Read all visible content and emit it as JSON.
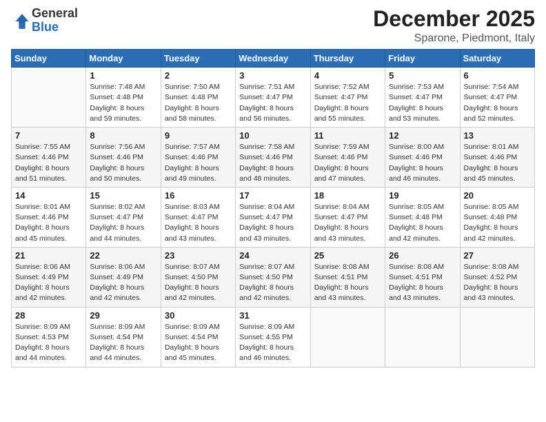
{
  "logo": {
    "general": "General",
    "blue": "Blue"
  },
  "header": {
    "month": "December 2025",
    "location": "Sparone, Piedmont, Italy"
  },
  "weekdays": [
    "Sunday",
    "Monday",
    "Tuesday",
    "Wednesday",
    "Thursday",
    "Friday",
    "Saturday"
  ],
  "weeks": [
    [
      {
        "day": "",
        "sunrise": "",
        "sunset": "",
        "daylight": ""
      },
      {
        "day": "1",
        "sunrise": "Sunrise: 7:48 AM",
        "sunset": "Sunset: 4:48 PM",
        "daylight": "Daylight: 8 hours and 59 minutes."
      },
      {
        "day": "2",
        "sunrise": "Sunrise: 7:50 AM",
        "sunset": "Sunset: 4:48 PM",
        "daylight": "Daylight: 8 hours and 58 minutes."
      },
      {
        "day": "3",
        "sunrise": "Sunrise: 7:51 AM",
        "sunset": "Sunset: 4:47 PM",
        "daylight": "Daylight: 8 hours and 56 minutes."
      },
      {
        "day": "4",
        "sunrise": "Sunrise: 7:52 AM",
        "sunset": "Sunset: 4:47 PM",
        "daylight": "Daylight: 8 hours and 55 minutes."
      },
      {
        "day": "5",
        "sunrise": "Sunrise: 7:53 AM",
        "sunset": "Sunset: 4:47 PM",
        "daylight": "Daylight: 8 hours and 53 minutes."
      },
      {
        "day": "6",
        "sunrise": "Sunrise: 7:54 AM",
        "sunset": "Sunset: 4:47 PM",
        "daylight": "Daylight: 8 hours and 52 minutes."
      }
    ],
    [
      {
        "day": "7",
        "sunrise": "Sunrise: 7:55 AM",
        "sunset": "Sunset: 4:46 PM",
        "daylight": "Daylight: 8 hours and 51 minutes."
      },
      {
        "day": "8",
        "sunrise": "Sunrise: 7:56 AM",
        "sunset": "Sunset: 4:46 PM",
        "daylight": "Daylight: 8 hours and 50 minutes."
      },
      {
        "day": "9",
        "sunrise": "Sunrise: 7:57 AM",
        "sunset": "Sunset: 4:46 PM",
        "daylight": "Daylight: 8 hours and 49 minutes."
      },
      {
        "day": "10",
        "sunrise": "Sunrise: 7:58 AM",
        "sunset": "Sunset: 4:46 PM",
        "daylight": "Daylight: 8 hours and 48 minutes."
      },
      {
        "day": "11",
        "sunrise": "Sunrise: 7:59 AM",
        "sunset": "Sunset: 4:46 PM",
        "daylight": "Daylight: 8 hours and 47 minutes."
      },
      {
        "day": "12",
        "sunrise": "Sunrise: 8:00 AM",
        "sunset": "Sunset: 4:46 PM",
        "daylight": "Daylight: 8 hours and 46 minutes."
      },
      {
        "day": "13",
        "sunrise": "Sunrise: 8:01 AM",
        "sunset": "Sunset: 4:46 PM",
        "daylight": "Daylight: 8 hours and 45 minutes."
      }
    ],
    [
      {
        "day": "14",
        "sunrise": "Sunrise: 8:01 AM",
        "sunset": "Sunset: 4:46 PM",
        "daylight": "Daylight: 8 hours and 45 minutes."
      },
      {
        "day": "15",
        "sunrise": "Sunrise: 8:02 AM",
        "sunset": "Sunset: 4:47 PM",
        "daylight": "Daylight: 8 hours and 44 minutes."
      },
      {
        "day": "16",
        "sunrise": "Sunrise: 8:03 AM",
        "sunset": "Sunset: 4:47 PM",
        "daylight": "Daylight: 8 hours and 43 minutes."
      },
      {
        "day": "17",
        "sunrise": "Sunrise: 8:04 AM",
        "sunset": "Sunset: 4:47 PM",
        "daylight": "Daylight: 8 hours and 43 minutes."
      },
      {
        "day": "18",
        "sunrise": "Sunrise: 8:04 AM",
        "sunset": "Sunset: 4:47 PM",
        "daylight": "Daylight: 8 hours and 43 minutes."
      },
      {
        "day": "19",
        "sunrise": "Sunrise: 8:05 AM",
        "sunset": "Sunset: 4:48 PM",
        "daylight": "Daylight: 8 hours and 42 minutes."
      },
      {
        "day": "20",
        "sunrise": "Sunrise: 8:05 AM",
        "sunset": "Sunset: 4:48 PM",
        "daylight": "Daylight: 8 hours and 42 minutes."
      }
    ],
    [
      {
        "day": "21",
        "sunrise": "Sunrise: 8:06 AM",
        "sunset": "Sunset: 4:49 PM",
        "daylight": "Daylight: 8 hours and 42 minutes."
      },
      {
        "day": "22",
        "sunrise": "Sunrise: 8:06 AM",
        "sunset": "Sunset: 4:49 PM",
        "daylight": "Daylight: 8 hours and 42 minutes."
      },
      {
        "day": "23",
        "sunrise": "Sunrise: 8:07 AM",
        "sunset": "Sunset: 4:50 PM",
        "daylight": "Daylight: 8 hours and 42 minutes."
      },
      {
        "day": "24",
        "sunrise": "Sunrise: 8:07 AM",
        "sunset": "Sunset: 4:50 PM",
        "daylight": "Daylight: 8 hours and 42 minutes."
      },
      {
        "day": "25",
        "sunrise": "Sunrise: 8:08 AM",
        "sunset": "Sunset: 4:51 PM",
        "daylight": "Daylight: 8 hours and 43 minutes."
      },
      {
        "day": "26",
        "sunrise": "Sunrise: 8:08 AM",
        "sunset": "Sunset: 4:51 PM",
        "daylight": "Daylight: 8 hours and 43 minutes."
      },
      {
        "day": "27",
        "sunrise": "Sunrise: 8:08 AM",
        "sunset": "Sunset: 4:52 PM",
        "daylight": "Daylight: 8 hours and 43 minutes."
      }
    ],
    [
      {
        "day": "28",
        "sunrise": "Sunrise: 8:09 AM",
        "sunset": "Sunset: 4:53 PM",
        "daylight": "Daylight: 8 hours and 44 minutes."
      },
      {
        "day": "29",
        "sunrise": "Sunrise: 8:09 AM",
        "sunset": "Sunset: 4:54 PM",
        "daylight": "Daylight: 8 hours and 44 minutes."
      },
      {
        "day": "30",
        "sunrise": "Sunrise: 8:09 AM",
        "sunset": "Sunset: 4:54 PM",
        "daylight": "Daylight: 8 hours and 45 minutes."
      },
      {
        "day": "31",
        "sunrise": "Sunrise: 8:09 AM",
        "sunset": "Sunset: 4:55 PM",
        "daylight": "Daylight: 8 hours and 46 minutes."
      },
      {
        "day": "",
        "sunrise": "",
        "sunset": "",
        "daylight": ""
      },
      {
        "day": "",
        "sunrise": "",
        "sunset": "",
        "daylight": ""
      },
      {
        "day": "",
        "sunrise": "",
        "sunset": "",
        "daylight": ""
      }
    ]
  ]
}
